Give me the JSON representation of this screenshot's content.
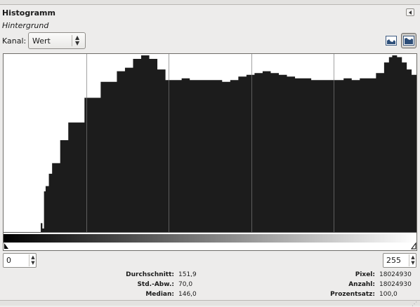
{
  "panel": {
    "title": "Histogramm",
    "subtitle": "Hintergrund"
  },
  "channel": {
    "label": "Kanal:",
    "selected": "Wert"
  },
  "icons": {
    "collapse": "collapse-left-icon",
    "linear": "linear-histogram-icon",
    "logarithmic": "logarithmic-histogram-icon",
    "range_low_marker": "range-start-marker-icon",
    "range_high_marker": "range-end-marker-icon"
  },
  "range": {
    "low": "0",
    "high": "255"
  },
  "stats": {
    "mean_label": "Durchschnitt:",
    "mean": "151,9",
    "stddev_label": "Std.-Abw.:",
    "stddev": "70,0",
    "median_label": "Median:",
    "median": "146,0",
    "pixels_label": "Pixel:",
    "pixels": "18024930",
    "count_label": "Anzahl:",
    "count": "18024930",
    "percentile_label": "Prozentsatz:",
    "percentile": "100,0"
  },
  "chart_data": {
    "type": "area",
    "x_range": [
      0,
      255
    ],
    "x": [
      0,
      10,
      20,
      22,
      23,
      24,
      25,
      26,
      28,
      30,
      35,
      40,
      50,
      60,
      70,
      75,
      80,
      85,
      90,
      95,
      100,
      105,
      110,
      115,
      120,
      125,
      130,
      135,
      140,
      145,
      150,
      155,
      160,
      165,
      170,
      175,
      180,
      185,
      190,
      195,
      200,
      205,
      210,
      215,
      220,
      225,
      230,
      235,
      238,
      240,
      243,
      246,
      249,
      252,
      255
    ],
    "y": [
      0,
      0,
      0,
      0,
      0.05,
      0.02,
      0.23,
      0.26,
      0.33,
      0.39,
      0.52,
      0.62,
      0.76,
      0.85,
      0.91,
      0.93,
      0.98,
      1.0,
      0.98,
      0.92,
      0.86,
      0.86,
      0.87,
      0.86,
      0.86,
      0.86,
      0.86,
      0.85,
      0.86,
      0.88,
      0.89,
      0.9,
      0.91,
      0.9,
      0.89,
      0.88,
      0.87,
      0.87,
      0.86,
      0.86,
      0.86,
      0.86,
      0.87,
      0.86,
      0.87,
      0.87,
      0.9,
      0.96,
      0.99,
      1.0,
      0.99,
      0.96,
      0.92,
      0.89,
      0.88
    ],
    "grid": true,
    "gradient_strip": true
  }
}
